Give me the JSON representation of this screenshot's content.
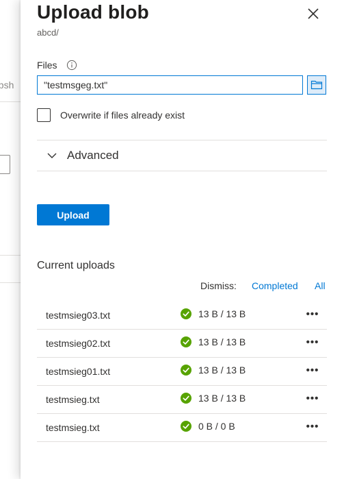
{
  "background": {
    "tab_fragment": "apsh"
  },
  "panel": {
    "title": "Upload blob",
    "subtitle": "abcd/",
    "files_label": "Files",
    "file_input_value": "\"testmsgeg.txt\"",
    "overwrite_label": "Overwrite if files already exist",
    "overwrite_checked": false,
    "advanced_label": "Advanced",
    "upload_button": "Upload"
  },
  "uploads": {
    "heading": "Current uploads",
    "dismiss_label": "Dismiss:",
    "dismiss_completed": "Completed",
    "dismiss_all": "All",
    "rows": [
      {
        "name": "testmsieg03.txt",
        "size": "13 B / 13 B",
        "status_icon": "check-circle-icon"
      },
      {
        "name": "testmsieg02.txt",
        "size": "13 B / 13 B",
        "status_icon": "check-circle-icon"
      },
      {
        "name": "testmsieg01.txt",
        "size": "13 B / 13 B",
        "status_icon": "check-circle-icon"
      },
      {
        "name": "testmsieg.txt",
        "size": "13 B / 13 B",
        "status_icon": "check-circle-icon"
      },
      {
        "name": "testmsieg.txt",
        "size": "0 B / 0 B",
        "status_icon": "check-circle-icon"
      }
    ],
    "more_glyph": "•••"
  },
  "colors": {
    "accent": "#0078d4",
    "success": "#57a300",
    "text": "#323130",
    "divider": "#e1dfdd"
  }
}
